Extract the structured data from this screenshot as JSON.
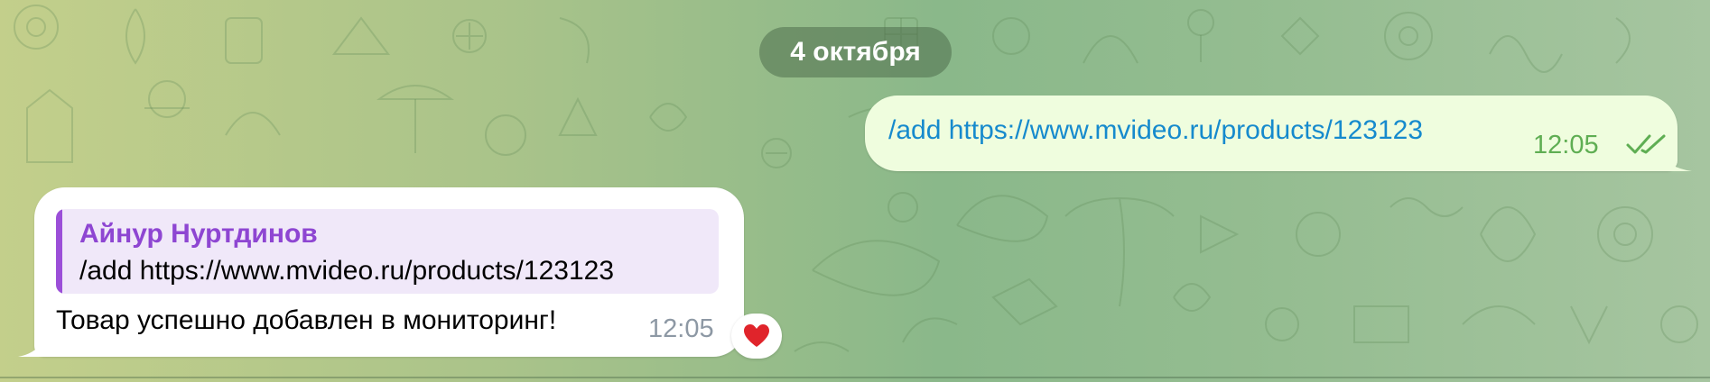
{
  "chat": {
    "date_separator": "4 октября",
    "outgoing": {
      "text": "/add https://www.mvideo.ru/products/123123",
      "time": "12:05",
      "status_icon": "double-check-icon"
    },
    "incoming": {
      "reply": {
        "author": "Айнур Нуртдинов",
        "text": "/add https://www.mvideo.ru/products/123123"
      },
      "text": "Товар успешно добавлен в мониторинг!",
      "time": "12:05",
      "reaction_icon": "heart-icon"
    }
  },
  "colors": {
    "link": "#168acd",
    "outgoing_bubble": "#effdde",
    "outgoing_time": "#5fae53",
    "reply_author": "#8e46d2",
    "reply_bar": "#9b4fd8",
    "reply_bg": "#f0e8f9",
    "incoming_time": "#8d98a4",
    "reaction": "#e0242b"
  }
}
